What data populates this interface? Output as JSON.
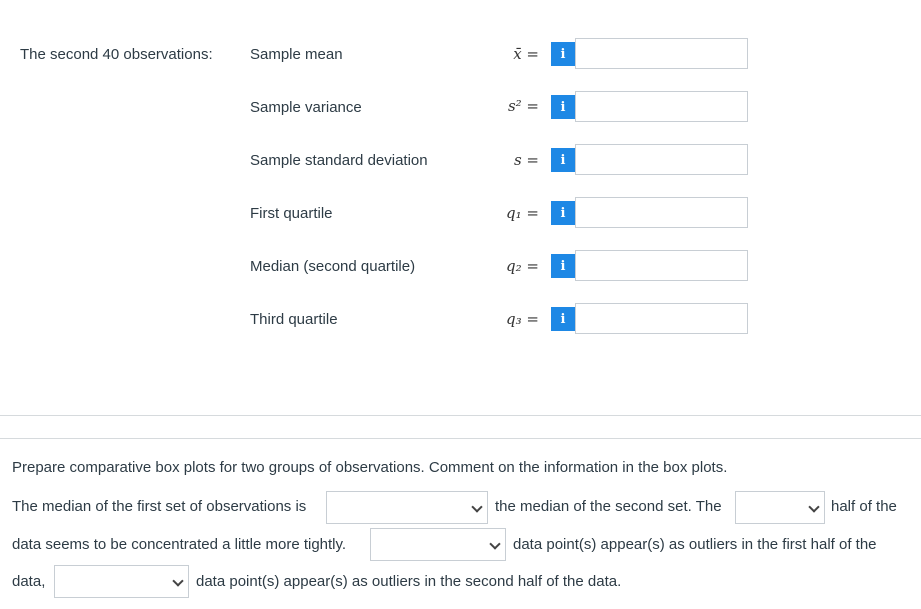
{
  "section_label": "The second 40 observations:",
  "rows": [
    {
      "label": "Sample mean",
      "symbol": "x̄ ="
    },
    {
      "label": "Sample variance",
      "symbol": "s² ="
    },
    {
      "label": "Sample standard deviation",
      "symbol": "s ="
    },
    {
      "label": "First quartile",
      "symbol": "q₁ ="
    },
    {
      "label": "Median (second quartile)",
      "symbol": "q₂ ="
    },
    {
      "label": "Third quartile",
      "symbol": "q₃ ="
    }
  ],
  "info_glyph": "i",
  "prompt": "Prepare comparative box plots for two groups of observations. Comment on the information in the box plots.",
  "sentence": {
    "part1": "The median of the first set of observations is",
    "part2": "the median of the second set. The",
    "part3": "half of the",
    "part4": "data seems to be concentrated a little more tightly.",
    "part5": "data point(s) appear(s) as outliers in the first half of the",
    "part6": "data,",
    "part7": "data point(s) appear(s) as outliers in the second half of the data."
  },
  "icons": {
    "info": "info-icon",
    "dropdown": "chevron-down-icon"
  },
  "colors": {
    "info_button": "#1e88e5",
    "text": "#2d3b45",
    "border": "#c8ced4"
  }
}
